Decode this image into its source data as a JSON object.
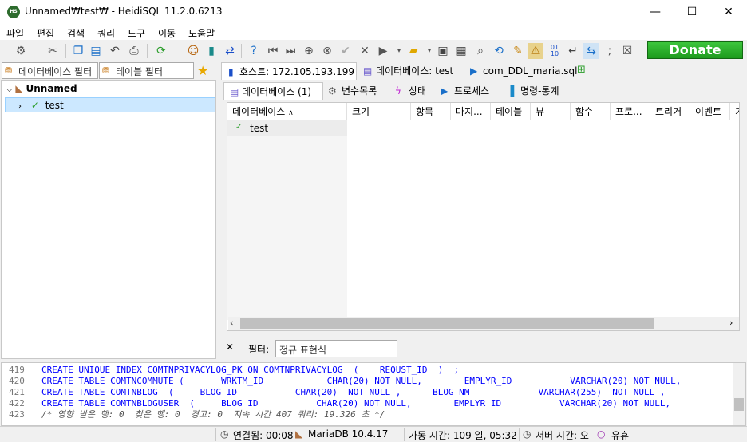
{
  "window": {
    "title": "Unnamed₩test₩ - HeidiSQL 11.2.0.6213",
    "minimize": "—",
    "maximize": "☐",
    "close": "✕",
    "app_icon_text": "HS"
  },
  "menu": [
    "파일",
    "편집",
    "검색",
    "쿼리",
    "도구",
    "이동",
    "도움말"
  ],
  "toolbar": {
    "donate_label": "Donate"
  },
  "left_panel": {
    "db_filter_placeholder": "데이터베이스 필터",
    "table_filter_placeholder": "테이블 필터",
    "tree": {
      "root_label": "Unnamed",
      "child_label": "test"
    }
  },
  "host_tabs": [
    "호스트: 172.105.193.199",
    "데이터베이스: test",
    "com_DDL_maria.sql"
  ],
  "sub_tabs": [
    "데이터베이스 (1)",
    "변수목록",
    "상태",
    "프로세스",
    "명령-통계"
  ],
  "grid": {
    "columns": [
      "데이터베이스",
      "크기",
      "항목",
      "마지...",
      "테이블",
      "뷰",
      "함수",
      "프로...",
      "트리거",
      "이벤트",
      "기"
    ],
    "rows": [
      [
        "test",
        "",
        "",
        "",
        "",
        "",
        "",
        "",
        "",
        "",
        ""
      ]
    ]
  },
  "filter": {
    "label": "필터:",
    "placeholder": "정규 표현식",
    "close_icon": "✕"
  },
  "sql_log": [
    {
      "num": "419",
      "text": "CREATE UNIQUE INDEX COMTNPRIVACYLOG_PK ON COMTNPRIVACYLOG  (    REQUST_ID  )  ;"
    },
    {
      "num": "420",
      "text": "CREATE TABLE COMTNCOMMUTE (       WRKTM_ID            CHAR(20) NOT NULL,        EMPLYR_ID           VARCHAR(20) NOT NULL,"
    },
    {
      "num": "421",
      "text": "CREATE TABLE COMTNBLOG  (     BLOG_ID           CHAR(20)  NOT NULL ,      BLOG_NM             VARCHAR(255)  NOT NULL ,"
    },
    {
      "num": "422",
      "text": "CREATE TABLE COMTNBLOGUSER  (     BLOG_ID           CHAR(20) NOT NULL,        EMPLYR_ID           VARCHAR(20) NOT NULL,"
    },
    {
      "num": "423",
      "text": "/* 영향 받은 행: 0  찾은 행: 0  경고: 0  지속 시간 407 쿼리: 19.326 초 */"
    }
  ],
  "status": {
    "connected": "연결됨: 00:08",
    "server": "MariaDB 10.4.17",
    "uptime": "가동 시간: 109 일, 05:32",
    "server_time": "서버 시간: 오",
    "idle": "유휴"
  }
}
